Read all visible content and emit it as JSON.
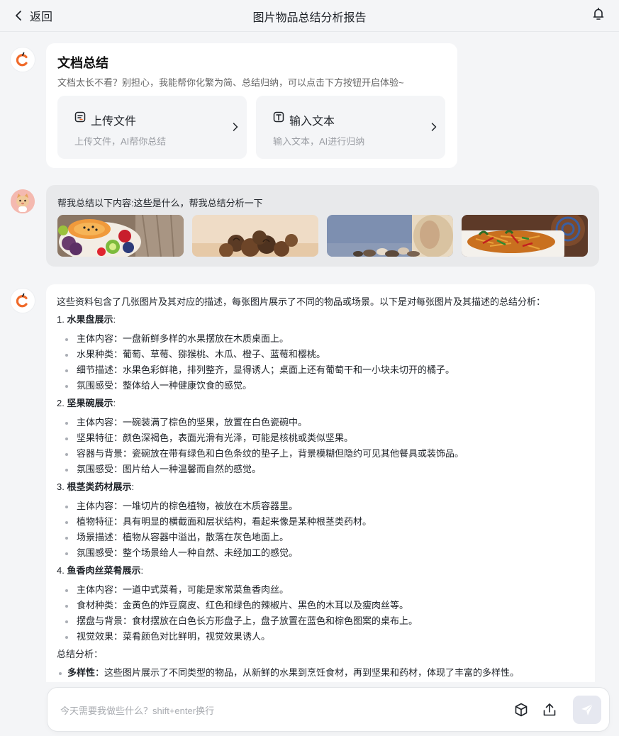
{
  "header": {
    "back_label": "返回",
    "title": "图片物品总结分析报告"
  },
  "doc_card": {
    "title": "文档总结",
    "description": "文档太长不看？别担心，我能帮你化繁为简、总结归纳，可以点击下方按钮开启体验~",
    "options": [
      {
        "label": "上传文件",
        "sub": "上传文件，AI帮你总结",
        "icon": "document-icon"
      },
      {
        "label": "输入文本",
        "sub": "输入文本，AI进行归纳",
        "icon": "text-icon"
      }
    ]
  },
  "user_message": {
    "text": "帮我总结以下内容:这些是什么，帮我总结分析一下",
    "images": [
      "fruit-plate-image",
      "nuts-bowl-image",
      "root-herb-image",
      "shredded-pork-dish-image"
    ]
  },
  "answer": {
    "intro": "这些资料包含了几张图片及其对应的描述，每张图片展示了不同的物品或场景。以下是对每张图片及其描述的总结分析：",
    "sections": [
      {
        "num": "1.",
        "title": "水果盘展示",
        "colon": ":",
        "items": [
          "主体内容：一盘新鲜多样的水果摆放在木质桌面上。",
          "水果种类：葡萄、草莓、猕猴桃、木瓜、橙子、蓝莓和樱桃。",
          "细节描述：水果色彩鲜艳，排列整齐，显得诱人；桌面上还有葡萄干和一小块未切开的橘子。",
          "氛围感受：整体给人一种健康饮食的感觉。"
        ]
      },
      {
        "num": "2.",
        "title": "坚果碗展示",
        "colon": ":",
        "items": [
          "主体内容：一碗装满了棕色的坚果，放置在白色瓷碗中。",
          "坚果特征：颜色深褐色，表面光滑有光泽，可能是核桃或类似坚果。",
          "容器与背景：瓷碗放在带有绿色和白色条纹的垫子上，背景模糊但隐约可见其他餐具或装饰品。",
          "氛围感受：图片给人一种温馨而自然的感觉。"
        ]
      },
      {
        "num": "3.",
        "title": "根茎类药材展示",
        "colon": ":",
        "items": [
          "主体内容：一堆切片的棕色植物，被放在木质容器里。",
          "植物特征：具有明显的横截面和层状结构，看起来像是某种根茎类药材。",
          "场景描述：植物从容器中溢出，散落在灰色地面上。",
          "氛围感受：整个场景给人一种自然、未经加工的感觉。"
        ]
      },
      {
        "num": "4.",
        "title": "鱼香肉丝菜肴展示",
        "colon": ":",
        "items": [
          "主体内容：一道中式菜肴，可能是家常菜鱼香肉丝。",
          "食材种类：金黄色的炸豆腐皮、红色和绿色的辣椒片、黑色的木耳以及瘦肉丝等。",
          "摆盘与背景：食材摆放在白色长方形盘子上，盘子放置在蓝色和棕色图案的桌布上。",
          "视觉效果：菜肴颜色对比鲜明，视觉效果诱人。"
        ]
      }
    ],
    "summary_title": "总结分析：",
    "summary_items": [
      {
        "bold": "多样性",
        "text": "：这些图片展示了不同类型的物品，从新鲜的水果到烹饪食材，再到坚果和药材，体现了丰富的多样性。"
      }
    ]
  },
  "input": {
    "placeholder": "今天需要我做些什么？shift+enter换行"
  },
  "colors": {
    "accent": "#f06a2a",
    "background": "#f4f5f7"
  }
}
